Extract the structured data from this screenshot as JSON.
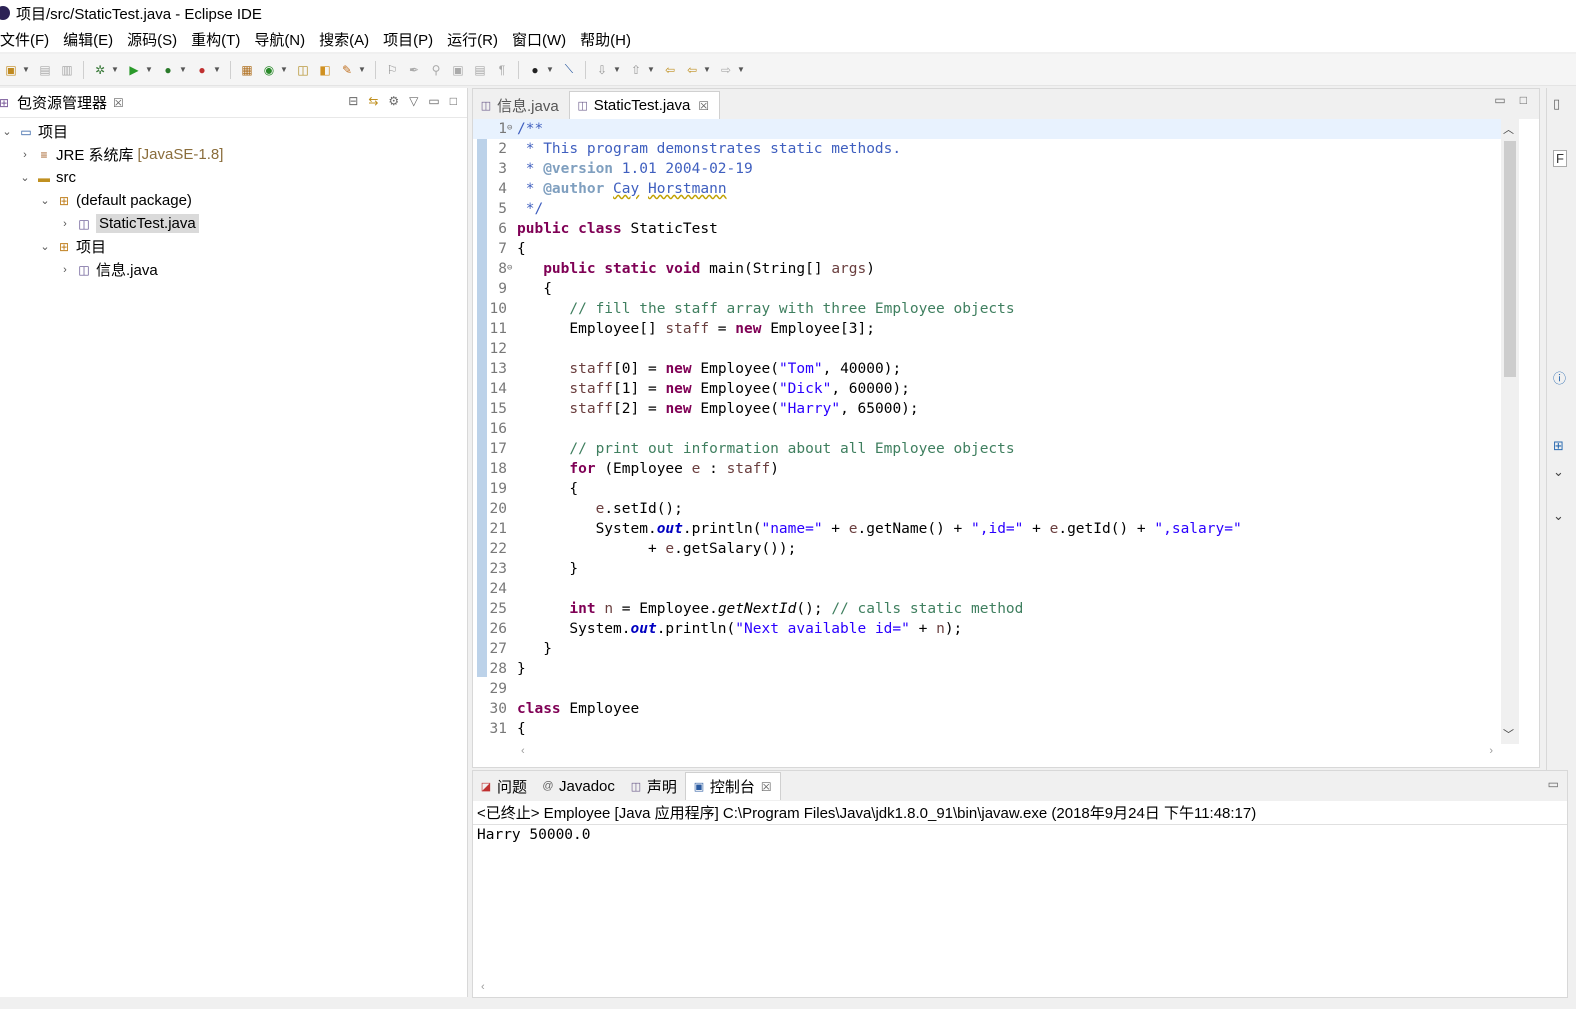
{
  "window": {
    "title": "项目/src/StaticTest.java - Eclipse IDE"
  },
  "menu": [
    "文件(F)",
    "编辑(E)",
    "源码(S)",
    "重构(T)",
    "导航(N)",
    "搜索(A)",
    "项目(P)",
    "运行(R)",
    "窗口(W)",
    "帮助(H)"
  ],
  "package_explorer": {
    "title": "包资源管理器",
    "tree": [
      {
        "label": "项目",
        "expanded": true,
        "icon": "project-icon"
      },
      {
        "label": "JRE 系统库",
        "decor": "[JavaSE-1.8]",
        "expanded": false,
        "icon": "library-icon"
      },
      {
        "label": "src",
        "expanded": true,
        "icon": "source-folder-icon"
      },
      {
        "label": "(default package)",
        "expanded": true,
        "icon": "package-icon"
      },
      {
        "label": "StaticTest.java",
        "expanded": false,
        "icon": "java-file-icon",
        "selected": true
      },
      {
        "label": "项目",
        "expanded": true,
        "icon": "package-icon"
      },
      {
        "label": "信息.java",
        "expanded": false,
        "icon": "java-file-icon"
      }
    ]
  },
  "editor": {
    "tabs": [
      {
        "label": "信息.java",
        "active": false
      },
      {
        "label": "StaticTest.java",
        "active": true
      }
    ],
    "current_line": 1,
    "lines": [
      "/**",
      " * This program demonstrates static methods.",
      " * @version 1.01 2004-02-19",
      " * @author Cay Horstmann",
      " */",
      "public class StaticTest",
      "{",
      "   public static void main(String[] args)",
      "   {",
      "      // fill the staff array with three Employee objects",
      "      Employee[] staff = new Employee[3];",
      "",
      "      staff[0] = new Employee(\"Tom\", 40000);",
      "      staff[1] = new Employee(\"Dick\", 60000);",
      "      staff[2] = new Employee(\"Harry\", 65000);",
      "",
      "      // print out information about all Employee objects",
      "      for (Employee e : staff)",
      "      {",
      "         e.setId();",
      "         System.out.println(\"name=\" + e.getName() + \",id=\" + e.getId() + \",salary=\"",
      "               + e.getSalary());",
      "      }",
      "",
      "      int n = Employee.getNextId(); // calls static method",
      "      System.out.println(\"Next available id=\" + n);",
      "   }",
      "}",
      "",
      "class Employee",
      "{"
    ]
  },
  "console": {
    "tabs": [
      "问题",
      "Javadoc",
      "声明",
      "控制台"
    ],
    "active_tab": "控制台",
    "status": "<已终止> Employee [Java 应用程序] C:\\Program Files\\Java\\jdk1.8.0_91\\bin\\javaw.exe  (2018年9月24日 下午11:48:17)",
    "output": "Harry 50000.0"
  }
}
